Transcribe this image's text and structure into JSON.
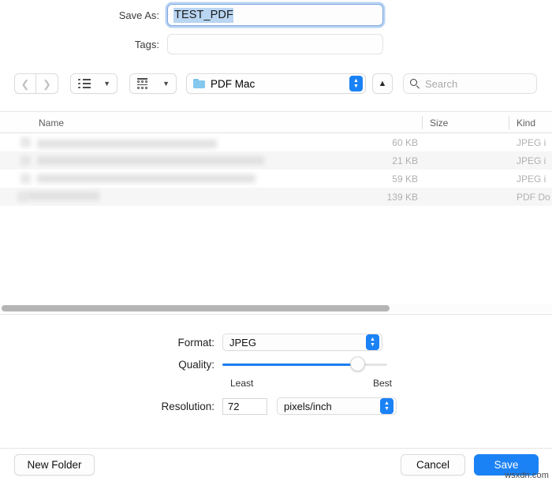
{
  "form": {
    "save_as_label": "Save As:",
    "save_as_value": "TEST_PDF",
    "tags_label": "Tags:",
    "tags_value": "",
    "tags_placeholder": ""
  },
  "toolbar": {
    "back_icon": "chevron-left-icon",
    "forward_icon": "chevron-right-icon",
    "list_view_icon": "list-view-icon",
    "grid_view_icon": "grid-view-icon",
    "path_label": "PDF Mac",
    "folder_icon": "folder-icon",
    "up_icon": "chevron-up-icon",
    "search_icon": "search-icon",
    "search_placeholder": "Search",
    "search_value": ""
  },
  "file_list": {
    "columns": [
      "Name",
      "Size",
      "Kind"
    ],
    "rows": [
      {
        "name": "",
        "size": "60 KB",
        "kind": "JPEG i"
      },
      {
        "name": "",
        "size": "21 KB",
        "kind": "JPEG i"
      },
      {
        "name": "",
        "size": "59 KB",
        "kind": "JPEG i"
      },
      {
        "name": "",
        "size": "139 KB",
        "kind": "PDF Do"
      }
    ]
  },
  "options": {
    "format_label": "Format:",
    "format_value": "JPEG",
    "quality_label": "Quality:",
    "quality_least": "Least",
    "quality_best": "Best",
    "quality_percent": 82,
    "resolution_label": "Resolution:",
    "resolution_value": "72",
    "resolution_units": "pixels/inch"
  },
  "footer": {
    "new_folder": "New Folder",
    "cancel": "Cancel",
    "save": "Save"
  },
  "watermark": "wsxdn.com",
  "colors": {
    "accent": "#1b82f5",
    "selection": "#b9d5f2",
    "focus_ring": "#82afeb"
  }
}
